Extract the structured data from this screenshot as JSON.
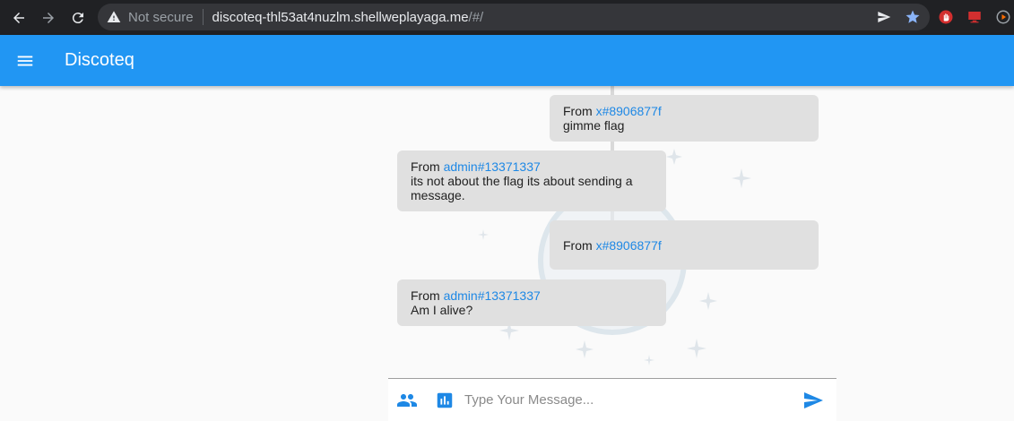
{
  "browser": {
    "security_label": "Not secure",
    "url_host": "discoteq-thl53at4nuzlm.shellweplayaga.me",
    "url_path": "/#/"
  },
  "app": {
    "title": "Discoteq"
  },
  "messages": [
    {
      "from_label": "From",
      "sender": "x#8906877f",
      "text": "gimme flag",
      "side": "right"
    },
    {
      "from_label": "From",
      "sender": "admin#13371337",
      "text": "its not about the flag its about sending a message.",
      "side": "left"
    },
    {
      "from_label": "From",
      "sender": "x#8906877f",
      "text": "",
      "side": "right"
    },
    {
      "from_label": "From",
      "sender": "admin#13371337",
      "text": "Am I alive?",
      "side": "left"
    }
  ],
  "composer": {
    "placeholder": "Type Your Message..."
  },
  "colors": {
    "appbar": "#2196f3",
    "chrome": "#202124",
    "bubble": "#e0e0e0",
    "sender_link": "#1e88e5"
  },
  "icons": {
    "back": "arrow-left-icon",
    "forward": "arrow-right-icon",
    "reload": "reload-icon",
    "warning": "warning-icon",
    "share": "send-tab-icon",
    "bookmark": "star-icon",
    "menu": "hamburger-menu-icon",
    "people": "people-icon",
    "poll": "bar-chart-icon",
    "send": "send-icon"
  }
}
